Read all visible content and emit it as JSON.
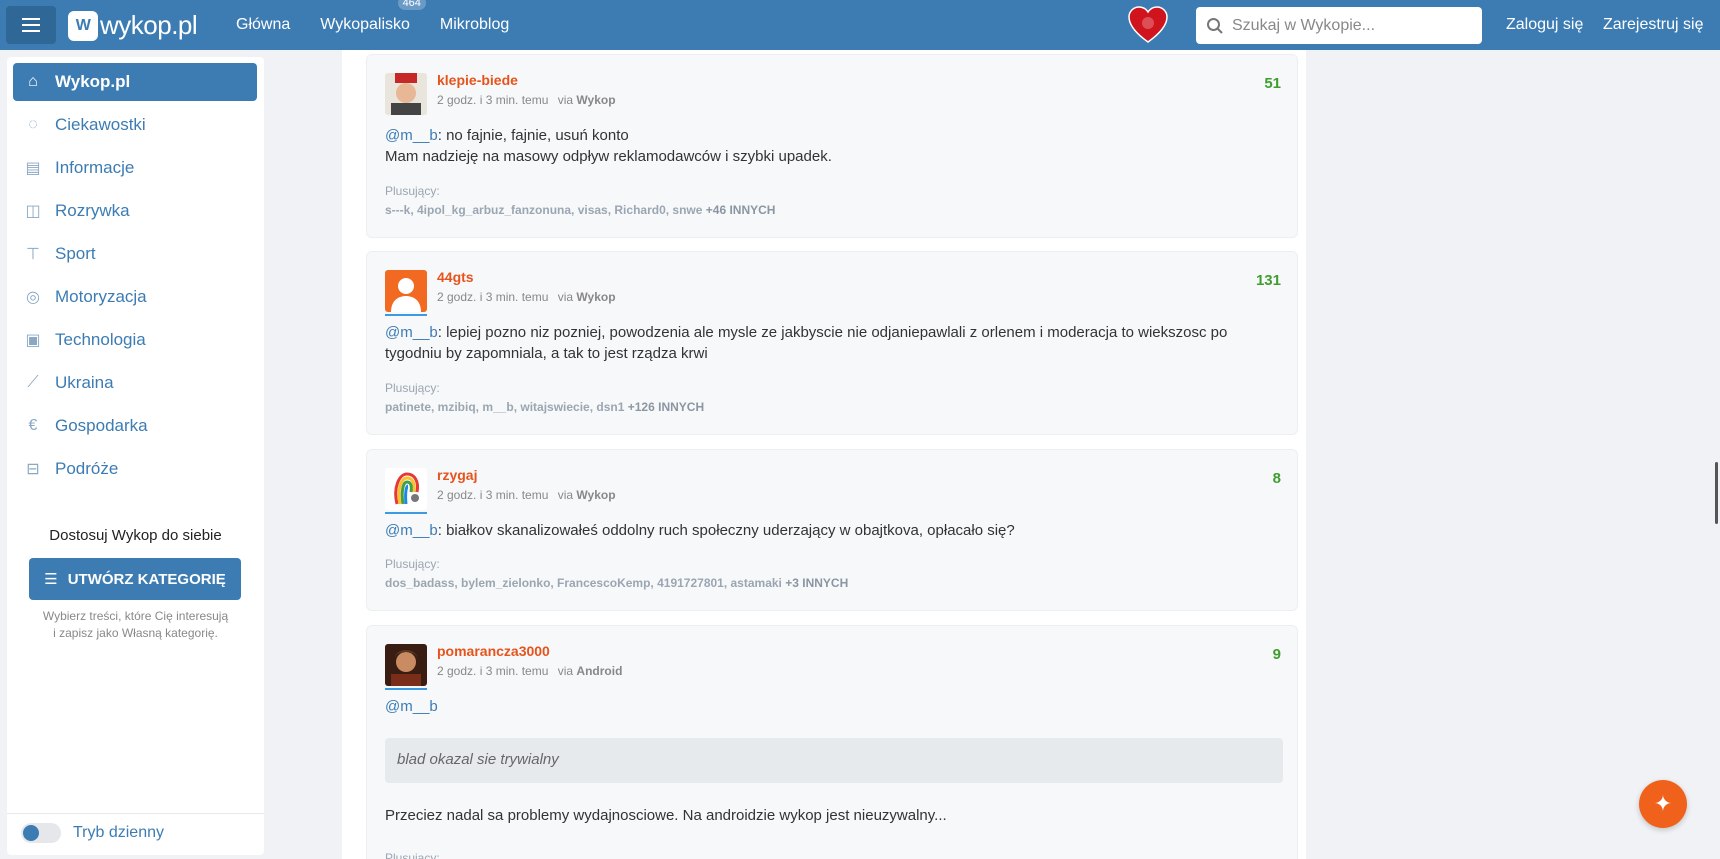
{
  "topbar": {
    "logo": "wykop.pl",
    "nav": [
      {
        "label": "Główna"
      },
      {
        "label": "Wykopalisko",
        "badge": "464"
      },
      {
        "label": "Mikroblog"
      }
    ],
    "search_placeholder": "Szukaj w Wykopie...",
    "login": "Zaloguj się",
    "register": "Zarejestruj się"
  },
  "sidebar": {
    "items": [
      {
        "label": "Wykop.pl",
        "icon": "home-icon"
      },
      {
        "label": "Ciekawostki",
        "icon": "lightbulb-icon"
      },
      {
        "label": "Informacje",
        "icon": "news-icon"
      },
      {
        "label": "Rozrywka",
        "icon": "gamepad-icon"
      },
      {
        "label": "Sport",
        "icon": "shirt-icon"
      },
      {
        "label": "Motoryzacja",
        "icon": "steering-wheel-icon"
      },
      {
        "label": "Technologia",
        "icon": "chip-icon"
      },
      {
        "label": "Ukraina",
        "icon": "ukraine-icon"
      },
      {
        "label": "Gospodarka",
        "icon": "euro-icon"
      },
      {
        "label": "Podróże",
        "icon": "suitcase-icon"
      }
    ],
    "customize_title": "Dostosuj Wykop do siebie",
    "create_button": "UTWÓRZ KATEGORIĘ",
    "customize_desc_1": "Wybierz treści, które Cię interesują",
    "customize_desc_2": "i zapisz jako Własną kategorię.",
    "day_mode": "Tryb dzienny"
  },
  "comments": [
    {
      "author": "klepie-biede",
      "time": "2 godz. i 3 min. temu",
      "via": "Wykop",
      "score": "51",
      "mention": "@m__b",
      "text_1": ": no fajnie, fajnie, usuń konto",
      "text_2": "Mam nadzieję na masowy odpływ reklamodawców i szybki upadek.",
      "plus_label": "Plusujący:",
      "plus_users": "s---k, 4ipol_kg_arbuz_fanzonuna, visas, Richard0, snwe",
      "plus_more": "+46 INNYCH"
    },
    {
      "author": "44gts",
      "time": "2 godz. i 3 min. temu",
      "via": "Wykop",
      "score": "131",
      "mention": "@m__b",
      "text_1": ": lepiej pozno niz pozniej, powodzenia ale mysle ze jakbyscie nie odjaniepawlali z orlenem i moderacja to wiekszosc po",
      "text_2": "tygodniu by zapomniala, a tak to jest rządza krwi",
      "plus_label": "Plusujący:",
      "plus_users": "patinete, mzibiq, m__b, witajswiecie, dsn1",
      "plus_more": "+126 INNYCH"
    },
    {
      "author": "rzygaj",
      "time": "2 godz. i 3 min. temu",
      "via": "Wykop",
      "score": "8",
      "mention": "@m__b",
      "text_1": ": białkov skanalizowałeś oddolny ruch społeczny uderzający w obajtkova, opłacało się?",
      "plus_label": "Plusujący:",
      "plus_users": "dos_badass, bylem_zielonko, FrancescoKemp, 4191727801, astamaki",
      "plus_more": "+3 INNYCH"
    },
    {
      "author": "pomarancza3000",
      "time": "2 godz. i 3 min. temu",
      "via": "Android",
      "score": "9",
      "mention": "@m__b",
      "quote": "blad okazal sie trywialny",
      "text_2": "Przeciez nadal sa problemy wydajnosciowe. Na androidzie wykop jest nieuzywalny...",
      "plus_label": "Plusujący:"
    }
  ],
  "via_prefix": "via"
}
